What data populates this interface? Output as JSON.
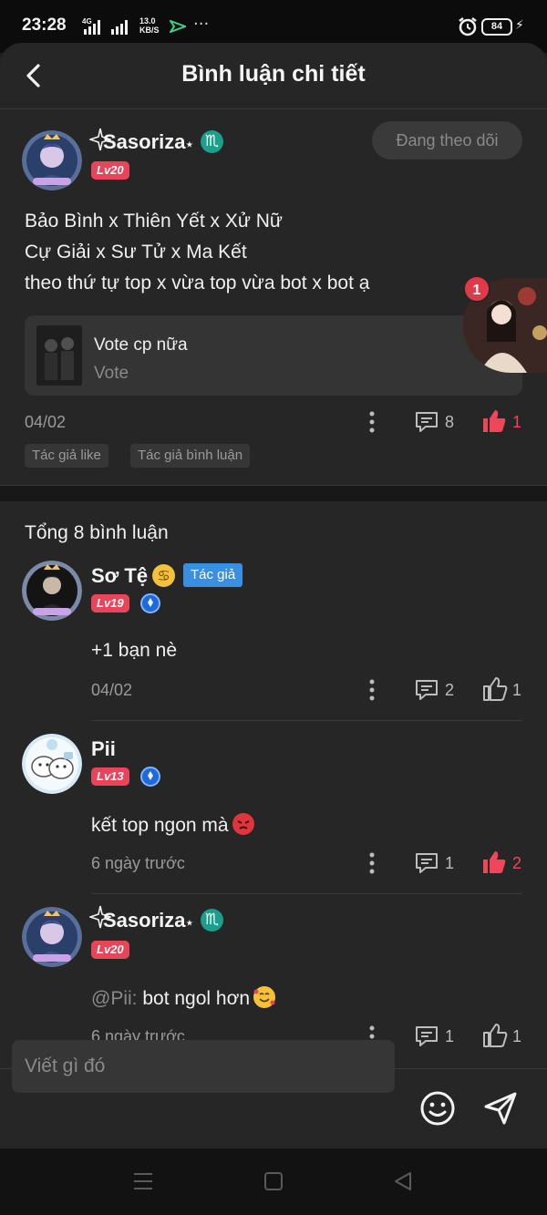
{
  "status_bar": {
    "time": "23:28",
    "network_4g": "4G",
    "speed_value": "13.0",
    "speed_unit": "KB/S",
    "battery": "84"
  },
  "header": {
    "title": "Bình luận chi tiết"
  },
  "post": {
    "author": "Sasoriza",
    "author_suffix": "⋆",
    "level": "Lv20",
    "follow_label": "Đang theo dõi",
    "lines": [
      "Bảo Bình x Thiên Yết x Xử Nữ",
      "Cự Giải x Sư Tử x Ma Kết",
      "theo thứ tự top x vừa top vừa bot x bot ạ"
    ],
    "vote_card": {
      "title": "Vote cp nữa",
      "subtitle": "Vote"
    },
    "date": "04/02",
    "comment_count": "8",
    "like_count": "1",
    "tags": [
      "Tác giả like",
      "Tác giả bình luận"
    ],
    "floating_badge": "1"
  },
  "comments_section": {
    "total_label": "Tổng 8 bình luận",
    "author_badge": "Tác giả"
  },
  "comments": [
    {
      "name": "Sơ Tệ",
      "level": "Lv19",
      "text": "+1 bạn nè",
      "date": "04/02",
      "reply_count": "2",
      "like_count": "1"
    },
    {
      "name": "Pii",
      "level": "Lv13",
      "text": "kết top ngon mà",
      "date": "6 ngày trước",
      "reply_count": "1",
      "like_count": "2"
    },
    {
      "name": "Sasoriza",
      "name_suffix": "⋆",
      "level": "Lv20",
      "mention": "@Pii:",
      "text": " bot ngol hơn",
      "date": "6 ngày trước",
      "reply_count": "1",
      "like_count": "1"
    }
  ],
  "composer": {
    "placeholder": "Viết gì đó"
  },
  "colors": {
    "background": "#262626",
    "accent_red": "#f0455a",
    "level_badge": "#e8455b",
    "author_badge": "#3a8fe0",
    "zodiac_teal": "#1a9f8a"
  },
  "icons": [
    "back-arrow-icon",
    "more-vertical-icon",
    "comment-icon",
    "thumbs-up-icon",
    "emoji-icon",
    "send-icon",
    "alarm-icon",
    "menu-icon",
    "home-square-icon",
    "back-triangle-icon"
  ]
}
